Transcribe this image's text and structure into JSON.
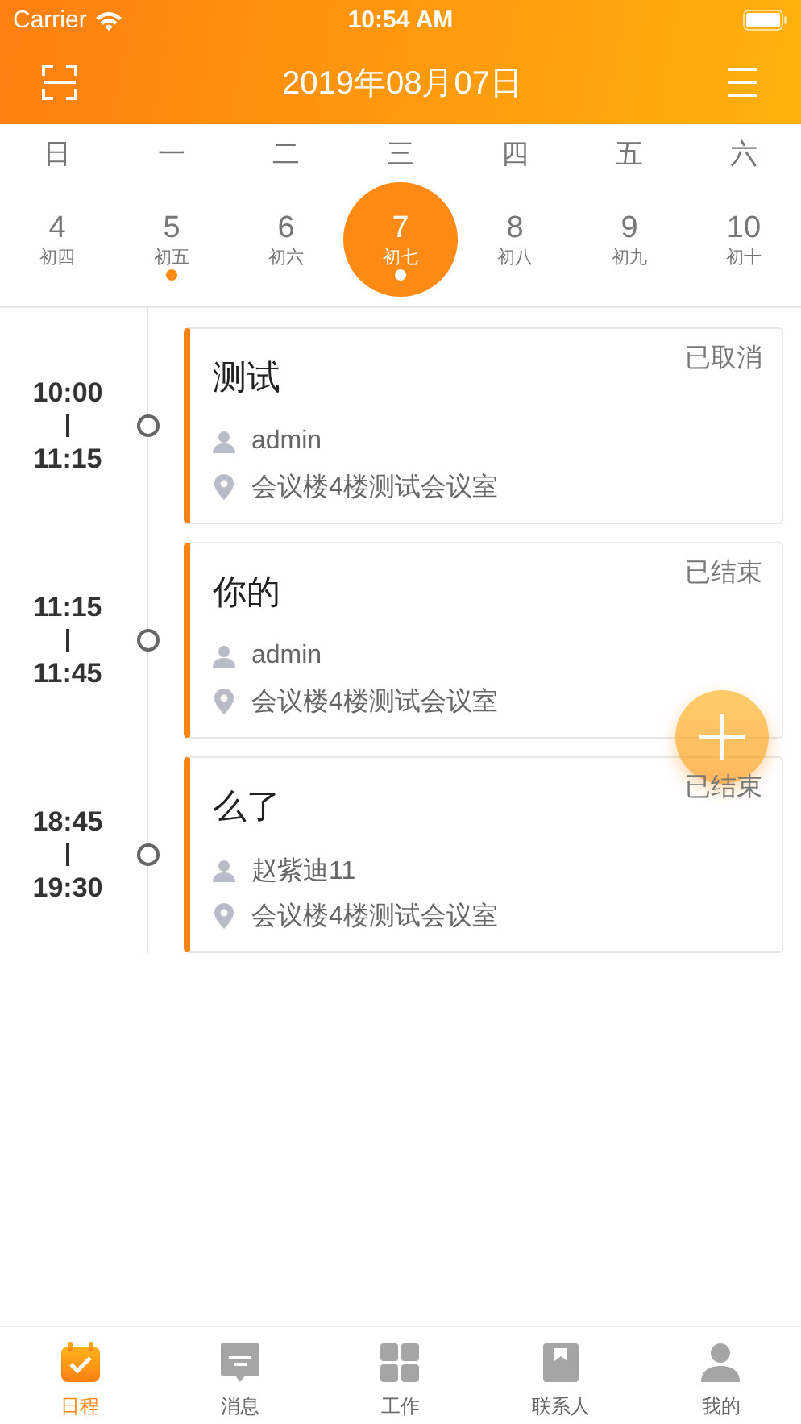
{
  "status_bar": {
    "carrier": "Carrier",
    "time": "10:54 AM"
  },
  "header": {
    "title": "2019年08月07日"
  },
  "weekdays": [
    "日",
    "一",
    "二",
    "三",
    "四",
    "五",
    "六"
  ],
  "days": [
    {
      "day": "4",
      "lunar": "初四",
      "selected": false,
      "has_event": false
    },
    {
      "day": "5",
      "lunar": "初五",
      "selected": false,
      "has_event": true
    },
    {
      "day": "6",
      "lunar": "初六",
      "selected": false,
      "has_event": false
    },
    {
      "day": "7",
      "lunar": "初七",
      "selected": true,
      "has_event": true
    },
    {
      "day": "8",
      "lunar": "初八",
      "selected": false,
      "has_event": false
    },
    {
      "day": "9",
      "lunar": "初九",
      "selected": false,
      "has_event": false
    },
    {
      "day": "10",
      "lunar": "初十",
      "selected": false,
      "has_event": false
    }
  ],
  "events": [
    {
      "start": "10:00",
      "end": "11:15",
      "title": "测试",
      "status": "已取消",
      "person": "admin",
      "location": "会议楼4楼测试会议室"
    },
    {
      "start": "11:15",
      "end": "11:45",
      "title": "你的",
      "status": "已结束",
      "person": "admin",
      "location": "会议楼4楼测试会议室"
    },
    {
      "start": "18:45",
      "end": "19:30",
      "title": "么了",
      "status": "已结束",
      "person": "赵紫迪11",
      "location": "会议楼4楼测试会议室"
    }
  ],
  "tab_bar": [
    {
      "label": "日程",
      "kind": "calendar",
      "selected": true
    },
    {
      "label": "消息",
      "kind": "message",
      "selected": false
    },
    {
      "label": "工作",
      "kind": "grid",
      "selected": false
    },
    {
      "label": "联系人",
      "kind": "contacts",
      "selected": false
    },
    {
      "label": "我的",
      "kind": "person",
      "selected": false
    }
  ]
}
